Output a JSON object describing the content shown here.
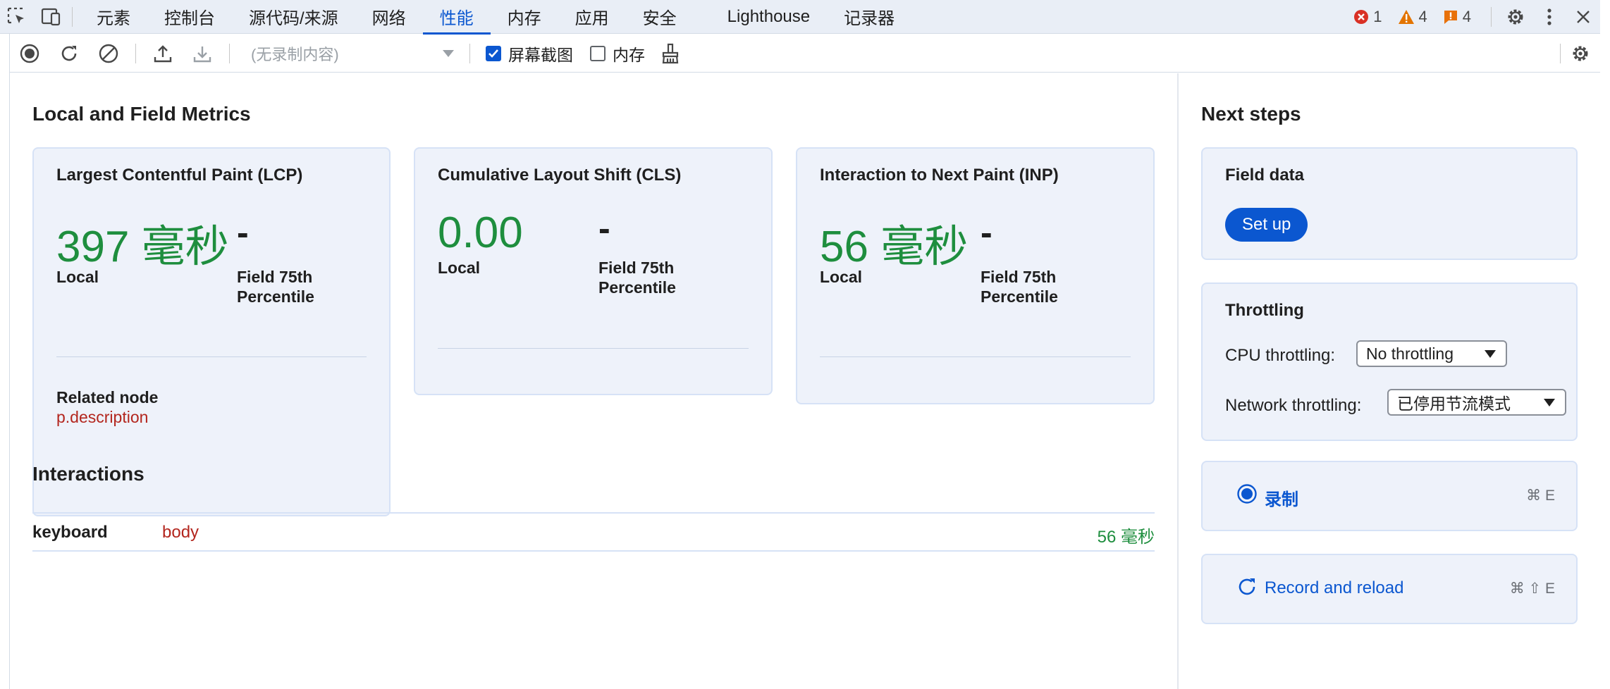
{
  "tabs": [
    {
      "label": "元素",
      "active": false
    },
    {
      "label": "控制台",
      "active": false
    },
    {
      "label": "源代码/来源",
      "active": false
    },
    {
      "label": "网络",
      "active": false
    },
    {
      "label": "性能",
      "active": true
    },
    {
      "label": "内存",
      "active": false
    },
    {
      "label": "应用",
      "active": false
    },
    {
      "label": "安全",
      "active": false
    },
    {
      "label": "Lighthouse",
      "active": false
    },
    {
      "label": "记录器",
      "active": false
    }
  ],
  "counters": {
    "errors": "1",
    "warnings": "4",
    "issues": "4"
  },
  "toolbar": {
    "recording_select": "(无录制内容)",
    "screenshots_label": "屏幕截图",
    "screenshots_checked": true,
    "memory_label": "内存",
    "memory_checked": false
  },
  "main": {
    "metrics_title": "Local and Field Metrics",
    "lcp": {
      "title": "Largest Contentful Paint (LCP)",
      "local_value": "397 毫秒",
      "field_value": "-",
      "local_label": "Local",
      "field_label": "Field 75th Percentile",
      "related_label": "Related node",
      "related_node": "p.description"
    },
    "cls": {
      "title": "Cumulative Layout Shift (CLS)",
      "local_value": "0.00",
      "field_value": "-",
      "local_label": "Local",
      "field_label": "Field 75th Percentile"
    },
    "inp": {
      "title": "Interaction to Next Paint (INP)",
      "local_value": "56 毫秒",
      "field_value": "-",
      "local_label": "Local",
      "field_label": "Field 75th Percentile"
    },
    "interactions_title": "Interactions",
    "interactions": [
      {
        "type": "keyboard",
        "node": "body",
        "duration": "56 毫秒"
      }
    ]
  },
  "sidebar": {
    "title": "Next steps",
    "field_data": {
      "title": "Field data",
      "button": "Set up"
    },
    "throttling": {
      "title": "Throttling",
      "cpu_label": "CPU throttling:",
      "cpu_value": "No throttling",
      "network_label": "Network throttling:",
      "network_value": "已停用节流模式"
    },
    "record": {
      "label": "录制",
      "shortcut": "⌘ E"
    },
    "record_reload": {
      "label": "Record and reload",
      "shortcut": "⌘ ⇧ E"
    }
  },
  "colors": {
    "accent": "#0b57d0",
    "good": "#1e8e3e",
    "node": "#b3261e",
    "card_bg": "#eef2fa"
  }
}
